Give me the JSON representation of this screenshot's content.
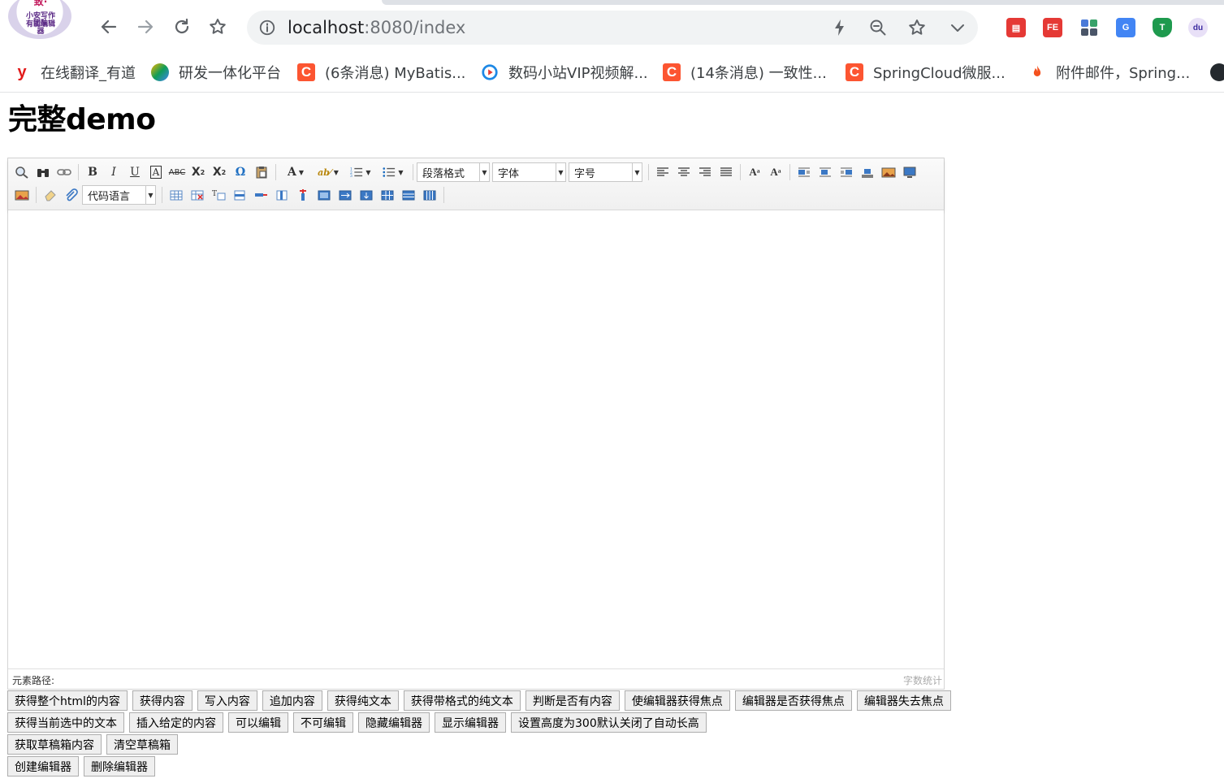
{
  "browser": {
    "tab_favicon_text": [
      "致·",
      "小安写作团队",
      "有能编辑器"
    ],
    "url_host": "localhost",
    "url_path": ":8080/index",
    "bookmarks": [
      {
        "label": "在线翻译_有道",
        "icon": "youdao-icon",
        "color": "#e21a1a"
      },
      {
        "label": "研发一体化平台",
        "icon": "platform-icon",
        "color": "#6aa84f"
      },
      {
        "label": "(6条消息) MyBatis...",
        "icon": "csdn-icon",
        "color": "#fc5531"
      },
      {
        "label": "数码小站VIP视频解...",
        "icon": "video-icon",
        "color": "#1e88e5"
      },
      {
        "label": "(14条消息) 一致性...",
        "icon": "csdn-icon",
        "color": "#fc5531"
      },
      {
        "label": "SpringCloud微服...",
        "icon": "csdn-icon",
        "color": "#fc5531"
      },
      {
        "label": "附件邮件，Spring...",
        "icon": "flame-icon",
        "color": "#f4511e"
      }
    ]
  },
  "page": {
    "title": "完整demo"
  },
  "editor": {
    "toolbar": {
      "paragraph_format": "段落格式",
      "font_family": "字体",
      "font_size": "字号",
      "code_language": "代码语言"
    },
    "status_path_label": "元素路径:",
    "word_count_label": "字数统计"
  },
  "buttons": {
    "row1": [
      "获得整个html的内容",
      "获得内容",
      "写入内容",
      "追加内容",
      "获得纯文本",
      "获得带格式的纯文本",
      "判断是否有内容",
      "使编辑器获得焦点",
      "编辑器是否获得焦点",
      "编辑器失去焦点"
    ],
    "row2": [
      "获得当前选中的文本",
      "插入给定的内容",
      "可以编辑",
      "不可编辑",
      "隐藏编辑器",
      "显示编辑器",
      "设置高度为300默认关闭了自动长高"
    ],
    "row3": [
      "获取草稿箱内容",
      "清空草稿箱"
    ],
    "row4": [
      "创建编辑器",
      "删除编辑器"
    ]
  }
}
